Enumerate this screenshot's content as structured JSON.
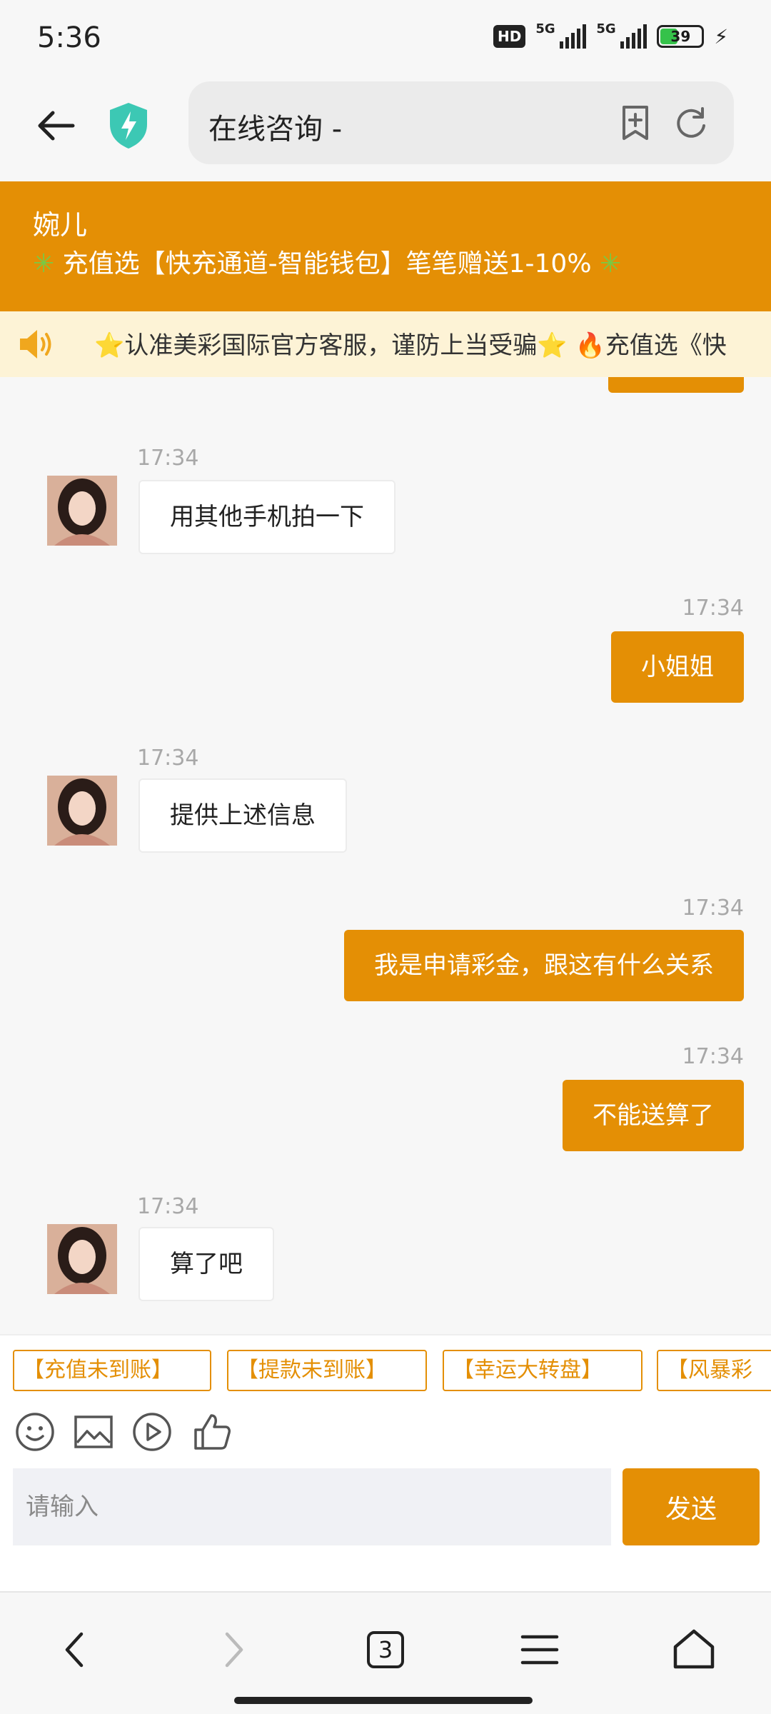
{
  "status_bar": {
    "time": "5:36",
    "hd_label": "HD",
    "network_1": "5G",
    "network_2": "5G",
    "battery": "39"
  },
  "browser": {
    "url_title": "在线咨询 -"
  },
  "chat_header": {
    "agent_name": "婉儿",
    "promo_star_left": "✳",
    "promo_text": "充值选【快充通道-智能钱包】笔笔赠送1-10%",
    "promo_star_right": "✳"
  },
  "marquee": {
    "text": "⭐认准美彩国际官方客服，谨防上当受骗⭐ 🔥充值选《快"
  },
  "messages": [
    {
      "direction": "in",
      "time": "17:34",
      "text": "用其他手机拍一下"
    },
    {
      "direction": "out",
      "time": "17:34",
      "text": "小姐姐"
    },
    {
      "direction": "in",
      "time": "17:34",
      "text": "提供上述信息"
    },
    {
      "direction": "out",
      "time": "17:34",
      "text": "我是申请彩金，跟这有什么关系"
    },
    {
      "direction": "out",
      "time": "17:34",
      "text": "不能送算了"
    },
    {
      "direction": "in",
      "time": "17:34",
      "text": "算了吧"
    }
  ],
  "quick_replies": [
    "【充值未到账】",
    "【提款未到账】",
    "【幸运大转盘】",
    "【风暴彩"
  ],
  "toolbar": {
    "icons": [
      "emoji-icon",
      "image-icon",
      "video-icon",
      "thumbs-up-icon"
    ]
  },
  "composer": {
    "placeholder": "请输入",
    "send_label": "发送"
  },
  "bottom_nav": {
    "tab_count": "3"
  },
  "colors": {
    "accent": "#e48f05",
    "marquee_bg": "#fdf3d6",
    "chat_bg": "#f7f7f7"
  }
}
